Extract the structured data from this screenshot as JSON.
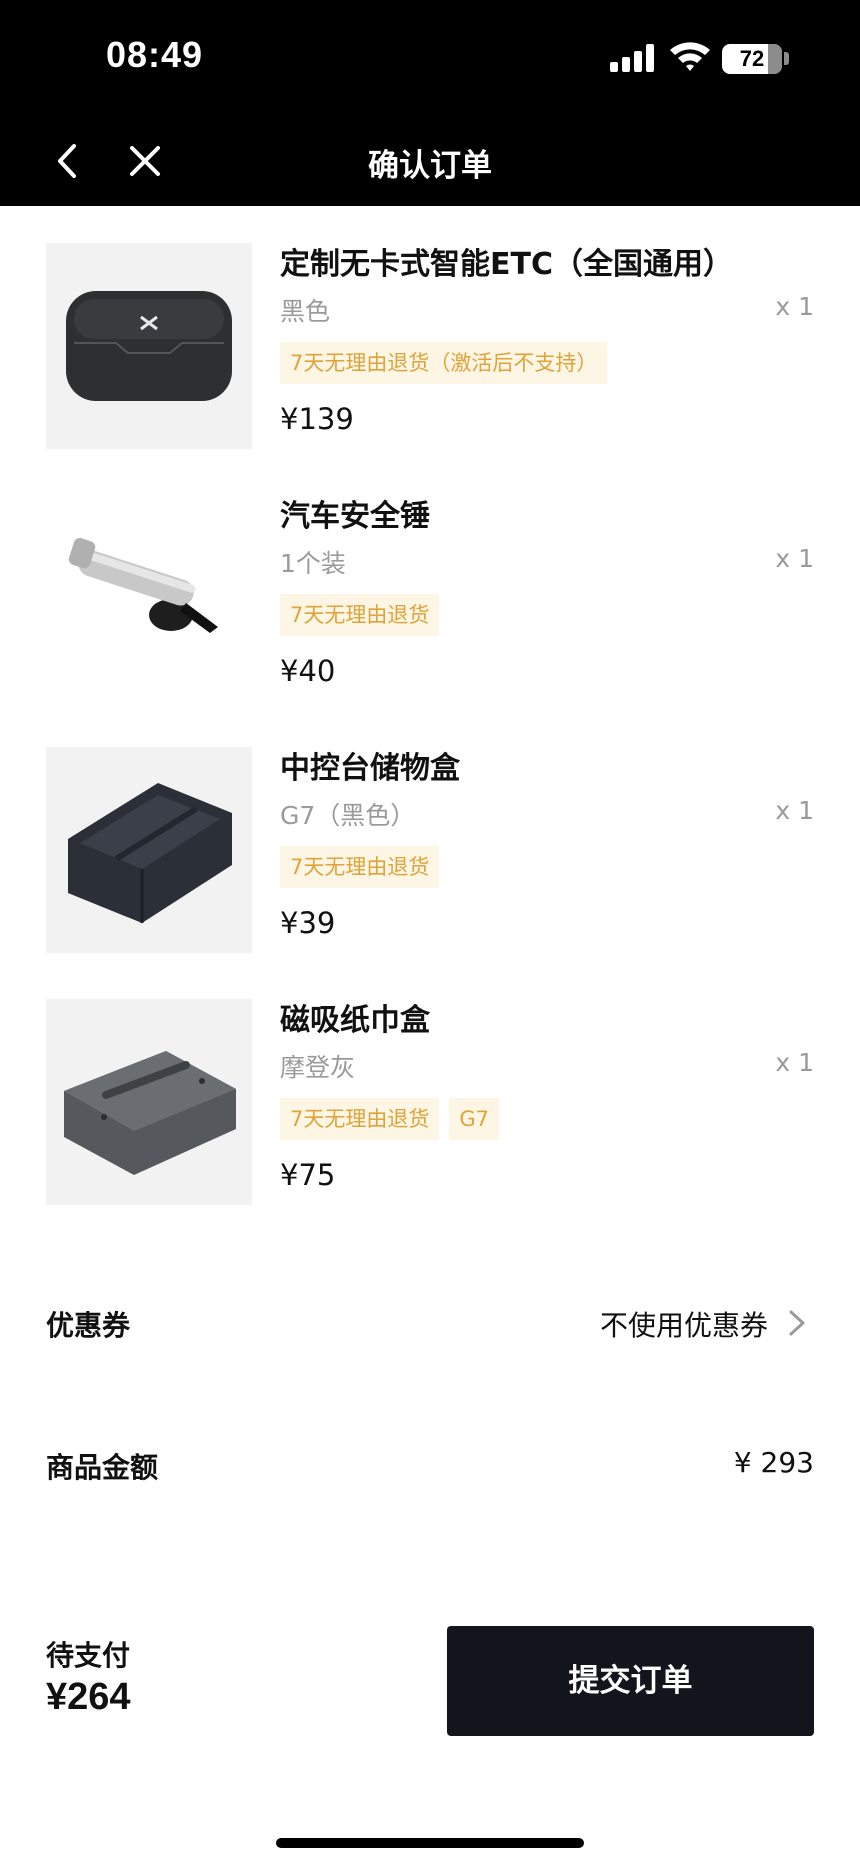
{
  "status_bar": {
    "time": "08:49",
    "battery": "72"
  },
  "nav": {
    "title": "确认订单"
  },
  "products": [
    {
      "name": "定制无卡式智能ETC（全国通用）",
      "spec": "黑色",
      "qty": "x 1",
      "tags": [
        "7天无理由退货（激活后不支持）"
      ],
      "price": "¥139",
      "image": "etc-device"
    },
    {
      "name": "汽车安全锤",
      "spec": "1个装",
      "qty": "x 1",
      "tags": [
        "7天无理由退货"
      ],
      "price": "¥40",
      "image": "safety-hammer"
    },
    {
      "name": "中控台储物盒",
      "spec": "G7（黑色）",
      "qty": "x 1",
      "tags": [
        "7天无理由退货"
      ],
      "price": "¥39",
      "image": "storage-box"
    },
    {
      "name": "磁吸纸巾盒",
      "spec": "摩登灰",
      "qty": "x 1",
      "tags": [
        "7天无理由退货",
        "G7"
      ],
      "price": "¥75",
      "image": "tissue-box"
    }
  ],
  "coupon": {
    "label": "优惠券",
    "value": "不使用优惠券"
  },
  "subtotal": {
    "label": "商品金额",
    "value": "¥ 293"
  },
  "footer": {
    "pay_label": "待支付",
    "pay_amount": "¥264",
    "submit_label": "提交订单"
  },
  "colors": {
    "tag_bg": "#fdf6e4",
    "tag_text": "#e0a33a",
    "button_bg": "#12151c",
    "header_bg": "#000000"
  }
}
